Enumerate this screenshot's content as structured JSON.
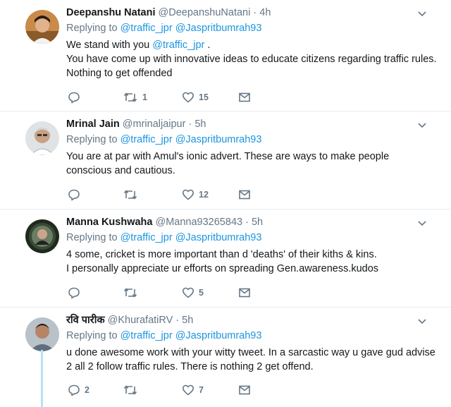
{
  "tweets": [
    {
      "fullname": "Deepanshu Natani",
      "handle": "@DeepanshuNatani",
      "time": "4h",
      "replying_prefix": "Replying to",
      "reply_mentions": [
        "@traffic_jpr",
        "@Jaspritbumrah93"
      ],
      "lines": [
        {
          "before": "We stand with you ",
          "mention": "@traffic_jpr",
          "after": " ."
        },
        {
          "before": "You have come up with innovative ideas to educate citizens regarding traffic rules.",
          "mention": "",
          "after": ""
        },
        {
          "before": "Nothing to get offended",
          "mention": "",
          "after": ""
        }
      ],
      "reply_count": "",
      "retweet_count": "1",
      "like_count": "15"
    },
    {
      "fullname": "Mrinal Jain",
      "handle": "@mrinaljaipur",
      "time": "5h",
      "replying_prefix": "Replying to",
      "reply_mentions": [
        "@traffic_jpr",
        "@Jaspritbumrah93"
      ],
      "lines": [
        {
          "before": "You are at par with Amul's ionic advert.  These are ways to make people",
          "mention": "",
          "after": ""
        },
        {
          "before": "conscious and cautious.",
          "mention": "",
          "after": ""
        }
      ],
      "reply_count": "",
      "retweet_count": "",
      "like_count": "12"
    },
    {
      "fullname": "Manna Kushwaha",
      "handle": "@Manna93265843",
      "time": "5h",
      "replying_prefix": "Replying to",
      "reply_mentions": [
        "@traffic_jpr",
        "@Jaspritbumrah93"
      ],
      "lines": [
        {
          "before": "4 some, cricket is more important than d 'deaths' of their kiths & kins.",
          "mention": "",
          "after": ""
        },
        {
          "before": "I personally appreciate ur efforts on spreading Gen.awareness.kudos",
          "mention": "",
          "after": ""
        }
      ],
      "reply_count": "",
      "retweet_count": "",
      "like_count": "5"
    },
    {
      "fullname": "रवि पारीक",
      "handle": "@KhurafatiRV",
      "time": "5h",
      "replying_prefix": "Replying to",
      "reply_mentions": [
        "@traffic_jpr",
        "@Jaspritbumrah93"
      ],
      "lines": [
        {
          "before": "u done awesome work with your witty tweet. In a sarcastic way u gave gud advise",
          "mention": "",
          "after": ""
        },
        {
          "before": "2 all 2 follow traffic rules. There is nothing 2 get offend.",
          "mention": "",
          "after": ""
        }
      ],
      "reply_count": "2",
      "retweet_count": "",
      "like_count": "7"
    }
  ],
  "separator": "·",
  "icons": {
    "reply": "reply-icon",
    "retweet": "retweet-icon",
    "like": "heart-icon",
    "dm": "envelope-icon",
    "more": "chevron-down-icon"
  },
  "colors": {
    "mention": "#1b95e0",
    "secondary": "#657786",
    "thread_line": "#b7e0f5"
  }
}
